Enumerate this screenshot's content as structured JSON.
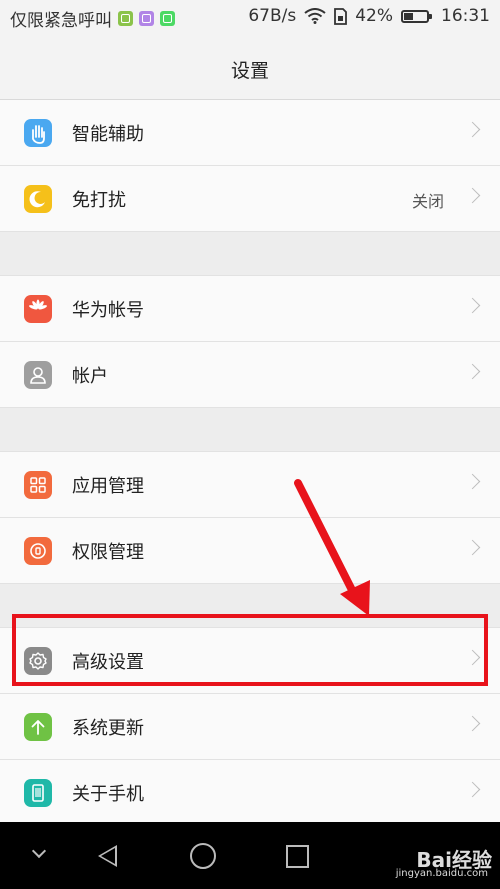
{
  "status_bar": {
    "carrier_text": "仅限紧急呼叫",
    "speed": "67B/s",
    "battery_percent": "42%",
    "battery_level": 0.42,
    "time": "16:31"
  },
  "header": {
    "title": "设置"
  },
  "settings": [
    {
      "label": "智能辅助",
      "value": "",
      "icon": "hand-icon",
      "color": "#4aa8f0"
    },
    {
      "label": "免打扰",
      "value": "关闭",
      "icon": "moon-icon",
      "color": "#f5c01a"
    },
    {
      "label": "华为帐号",
      "value": "",
      "icon": "huawei-logo-icon",
      "color": "#f0573f"
    },
    {
      "label": "帐户",
      "value": "",
      "icon": "person-icon",
      "color": "#9e9e9e"
    },
    {
      "label": "应用管理",
      "value": "",
      "icon": "grid-icon",
      "color": "#f26a3d"
    },
    {
      "label": "权限管理",
      "value": "",
      "icon": "permission-icon",
      "color": "#f26a3d"
    },
    {
      "label": "高级设置",
      "value": "",
      "icon": "gear-icon",
      "color": "#8a8a8a"
    },
    {
      "label": "系统更新",
      "value": "",
      "icon": "update-arrow-icon",
      "color": "#6fc244"
    },
    {
      "label": "关于手机",
      "value": "",
      "icon": "phone-icon",
      "color": "#1fb8a8"
    }
  ],
  "annotation": {
    "color": "#e8131b"
  },
  "watermark": {
    "main": "Bai经验",
    "sub": "jingyan.baidu.com"
  }
}
